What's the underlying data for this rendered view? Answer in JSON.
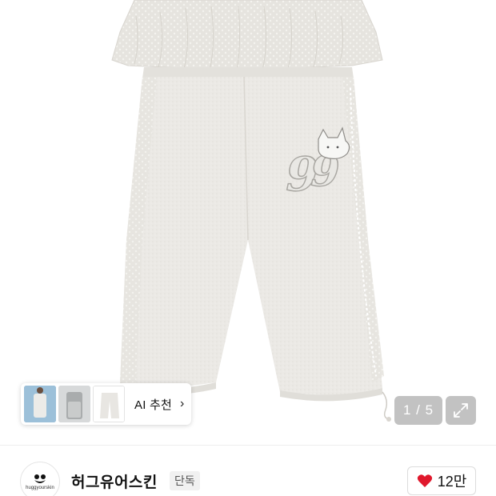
{
  "gallery": {
    "thumbnails": [
      {
        "name": "thumbnail-model-front"
      },
      {
        "name": "thumbnail-model-back"
      },
      {
        "name": "thumbnail-product-flat"
      }
    ],
    "ai_recommend_label": "AI 추천",
    "chevron": "›",
    "counter_text": "1 / 5",
    "expand_icon": "expand-icon"
  },
  "brand": {
    "logo_text": "huggyourskin",
    "name": "허그유어스킨",
    "badge": "단독"
  },
  "like": {
    "icon": "heart-icon",
    "count": "12만",
    "accent": "#e0182c"
  }
}
